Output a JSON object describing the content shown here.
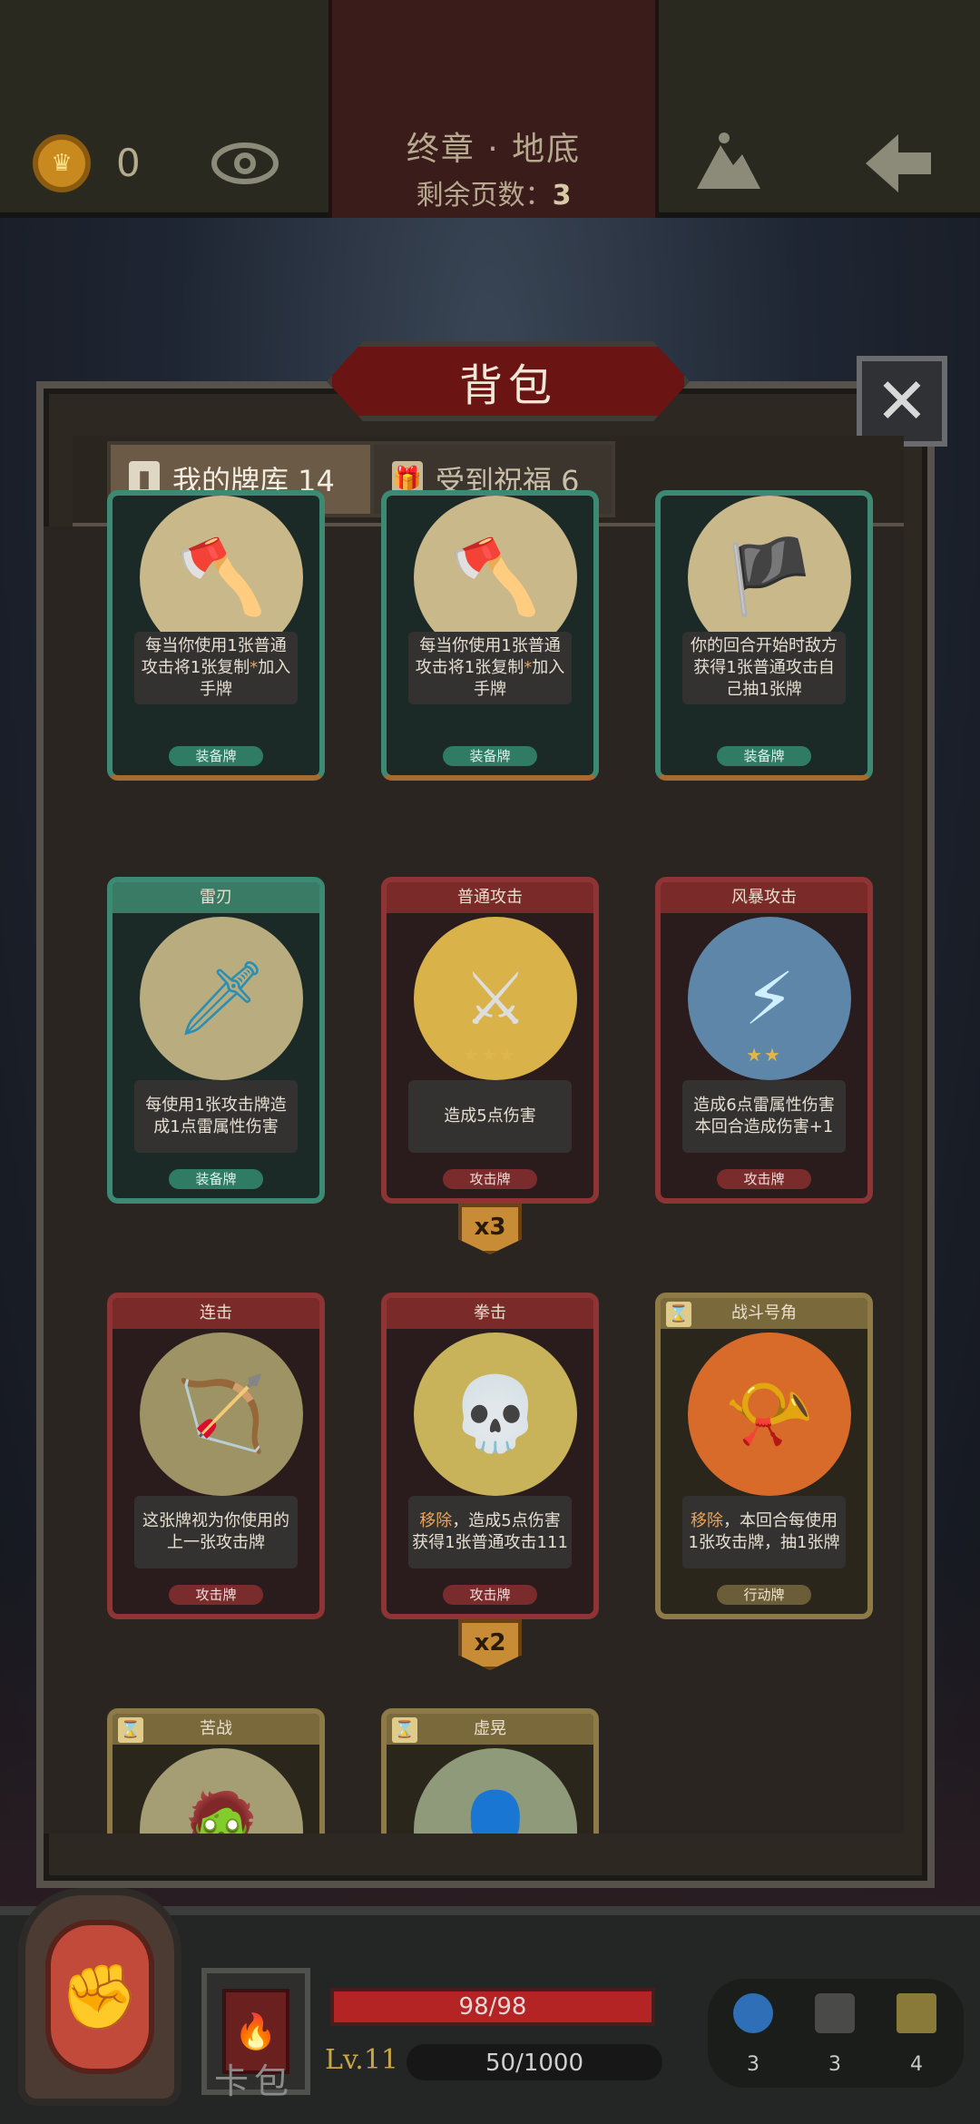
{
  "topbar": {
    "coins": "0",
    "chapter": "终章 · 地底",
    "pages_label": "剩余页数：",
    "pages_value": "3"
  },
  "panel": {
    "title": "背包",
    "close_label": "✕",
    "tabs": [
      {
        "label": "我的牌库 14",
        "active": true
      },
      {
        "label": "受到祝福 6",
        "active": false
      }
    ]
  },
  "cards": [
    {
      "name": "",
      "desc_pre": "每当你使用1张普通攻击将1张复制",
      "desc_em": "*",
      "desc_post": "加入手牌",
      "type": "装备牌"
    },
    {
      "name": "",
      "desc_pre": "每当你使用1张普通攻击将1张复制",
      "desc_em": "*",
      "desc_post": "加入手牌",
      "type": "装备牌"
    },
    {
      "name": "",
      "desc": "你的回合开始时敌方获得1张普通攻击自己抽1张牌",
      "type": "装备牌"
    },
    {
      "name": "雷刃",
      "desc": "每使用1张攻击牌造成1点雷属性伤害",
      "type": "装备牌"
    },
    {
      "name": "普通攻击",
      "desc": "造成5点伤害",
      "type": "攻击牌",
      "stars": "★★★",
      "count": "x3"
    },
    {
      "name": "风暴攻击",
      "desc": "造成6点雷属性伤害本回合造成伤害+1",
      "type": "攻击牌",
      "stars": "★★"
    },
    {
      "name": "连击",
      "desc": "这张牌视为你使用的上一张攻击牌",
      "type": "攻击牌"
    },
    {
      "name": "拳击",
      "desc_em": "移除",
      "desc_post": "，造成5点伤害获得1张普通攻击111",
      "type": "攻击牌",
      "count": "x2"
    },
    {
      "name": "战斗号角",
      "desc_em": "移除",
      "desc_post": "，本回合每使用1张攻击牌，抽1张牌",
      "type": "行动牌",
      "timed": true
    },
    {
      "name": "苦战",
      "timed": true
    },
    {
      "name": "虚晃",
      "timed": true
    }
  ],
  "bottom": {
    "deck_label": "卡包",
    "hp_text": "98/98",
    "hp_fraction": 1.0,
    "level": "Lv.11",
    "xp_text": "50/1000",
    "xp_fraction": 0.05,
    "resources": [
      {
        "icon": "potion-icon",
        "count": "3"
      },
      {
        "icon": "hourglass-icon",
        "count": "3"
      },
      {
        "icon": "cards-icon",
        "count": "4"
      }
    ]
  },
  "colors": {
    "accent_red": "#6b1414",
    "equip_teal": "#3c8a73",
    "attack_red": "#8f3434",
    "action_gold": "#8e7a46",
    "hp_red": "#b42424"
  }
}
